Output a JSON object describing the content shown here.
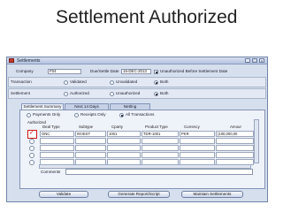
{
  "slide": {
    "title": "Settlement Authorized"
  },
  "window": {
    "title": "Settlements",
    "controls": [
      "_",
      "□",
      "x"
    ]
  },
  "header": {
    "company_label": "Company",
    "company_value": "F04",
    "due_date_label": "Due/Settle Date",
    "due_date_value": "16-DEC-2013",
    "unauthorized_label": "Unauthorized Before Settlement Date"
  },
  "transaction": {
    "label": "Transaction",
    "options": [
      "Validated",
      "Unvalidated",
      "Both"
    ],
    "selected": "Both"
  },
  "settlement": {
    "label": "Settlement",
    "options": [
      "Authorized",
      "Unauthorized",
      "Both"
    ],
    "selected": "Both"
  },
  "tabs": [
    {
      "label": "Settlement Summary",
      "active": true
    },
    {
      "label": "Next 14 Days",
      "active": false
    },
    {
      "label": "Netting",
      "active": false
    }
  ],
  "filter": {
    "options": [
      "Payments Only",
      "Receipts Only",
      "All Transactions"
    ],
    "selected": "All Transactions"
  },
  "grid": {
    "authorized_label": "Authorized",
    "columns": [
      "Deal Type",
      "Subtype",
      "Cparty",
      "Product Type",
      "Currency",
      "Amour"
    ],
    "rows": [
      [
        "ONC",
        "INVEST",
        "1001",
        "TDR-1001",
        "PKR",
        "(100,000,00"
      ],
      [
        "",
        "",
        "",
        "",
        "",
        ""
      ],
      [
        "",
        "",
        "",
        "",
        "",
        ""
      ],
      [
        "",
        "",
        "",
        "",
        "",
        ""
      ],
      [
        "",
        "",
        "",
        "",
        "",
        ""
      ]
    ]
  },
  "comments_label": "Comments",
  "buttons": {
    "validate": "Validate",
    "report": "Generate Report/Script",
    "maintain": "Maintain Settlements"
  }
}
